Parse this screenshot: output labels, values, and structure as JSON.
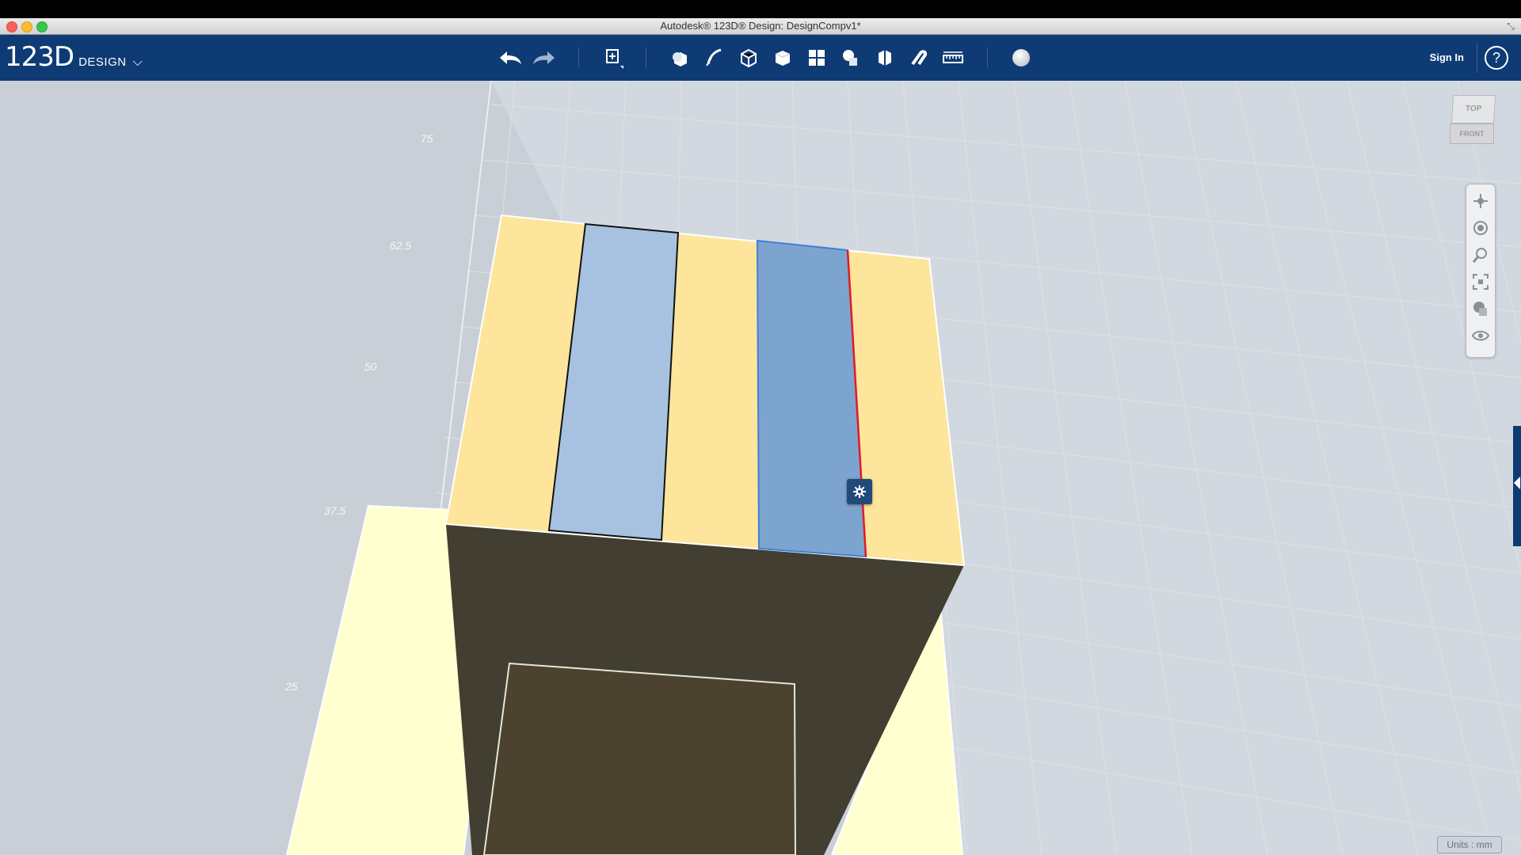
{
  "window": {
    "title": "Autodesk® 123D® Design: DesignCompv1*"
  },
  "toolbar": {
    "logo_main": "123D",
    "logo_sub": "DESIGN",
    "sign_in": "Sign In",
    "help": "?",
    "tools": [
      "undo-icon",
      "redo-icon",
      "transform-icon",
      "primitives-icon",
      "sketch-icon",
      "construct-icon",
      "modify-icon",
      "pattern-icon",
      "grouping-icon",
      "combine-icon",
      "snap-icon",
      "measure-icon",
      "material-icon"
    ]
  },
  "viewport": {
    "grid_labels": [
      "75",
      "62.5",
      "50",
      "37.5",
      "25"
    ],
    "viewcube": {
      "top": "TOP",
      "front": "FRONT"
    },
    "navigation": [
      "pan-icon",
      "orbit-icon",
      "zoom-icon",
      "fit-icon",
      "view-mode-icon",
      "visibility-icon"
    ],
    "units": "Units : mm"
  },
  "colors": {
    "toolbar_bg": "#0e3b74",
    "face_yellow": "#fce59b",
    "panel_blue": "#a7c2e0",
    "panel_blue_selected": "#7da4cf",
    "dark_face": "#423e31",
    "edge_selected": "#e01a2a"
  }
}
